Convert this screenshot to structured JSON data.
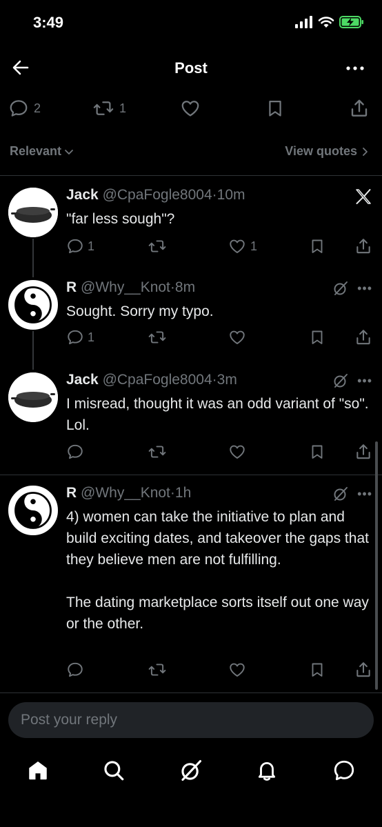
{
  "status_bar": {
    "time": "3:49"
  },
  "header": {
    "title": "Post"
  },
  "post_actions": {
    "reply_count": "2",
    "repost_count": "1"
  },
  "sort": {
    "relevant_label": "Relevant",
    "view_quotes_label": "View quotes"
  },
  "tweets": [
    {
      "name": "Jack",
      "handle": "@CpaFogle8004",
      "time": "10m",
      "text": "\"far less sough\"?",
      "reply_count": "1",
      "like_count": "1"
    },
    {
      "name": "R",
      "handle": "@Why__Knot",
      "time": "8m",
      "text": "Sought. Sorry my typo.",
      "reply_count": "1",
      "like_count": ""
    },
    {
      "name": "Jack",
      "handle": "@CpaFogle8004",
      "time": "3m",
      "text": "I misread, thought it was an odd variant of \"so\". Lol.",
      "reply_count": "",
      "like_count": ""
    },
    {
      "name": "R",
      "handle": "@Why__Knot",
      "time": "1h",
      "text": "4) women can take the initiative to plan and build exciting dates, and takeover the gaps that they believe men are not fulfilling.\n\nThe dating marketplace sorts itself out one way or the other.",
      "reply_count": "",
      "like_count": ""
    }
  ],
  "reply_box": {
    "placeholder": "Post your reply"
  },
  "colors": {
    "background": "#000000",
    "text": "#e7e9ea",
    "muted": "#71767b",
    "divider": "#2f3336",
    "battery": "#4cd964"
  },
  "icons": [
    "back-arrow-icon",
    "more-icon",
    "reply-icon",
    "repost-icon",
    "like-icon",
    "bookmark-icon",
    "share-icon",
    "x-logo-icon",
    "grok-icon",
    "home-icon",
    "search-icon",
    "bell-icon",
    "messages-icon"
  ]
}
